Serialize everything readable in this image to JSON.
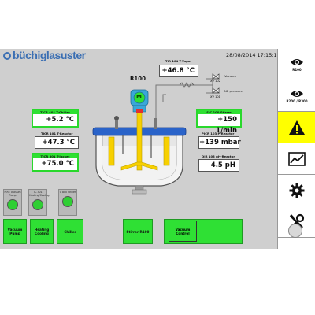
{
  "header": {
    "logo_text": "büchiglasuster",
    "datetime": "28/08/2014 17:15:19"
  },
  "reactor": {
    "title": "R100",
    "vapor_label": "TIR 104 T-Vapor",
    "vapor_value": "+46.8 °C",
    "chiller_label": "TICR 401 T-Chiller",
    "chiller_value": "+5.2 °C",
    "reactor_temp_label": "TICR 101 T-Reactor",
    "reactor_temp_value": "+47.3 °C",
    "jacket_label": "TICR 301 T-Jacket",
    "jacket_value": "+75.0 °C",
    "stirrer_label": "SIC 100 Stirrer",
    "stirrer_value": "+150 1/min",
    "pressure_label": "PICR 103 P-Reactor",
    "pressure_value": "+139 mbar",
    "ph_label": "QIR 103 pH-Reactor",
    "ph_value": "4.5 pH",
    "valve_vacuum_label": "Vacuum",
    "valve_n2_label": "N2 pressure",
    "valve1_tag": "XV 102",
    "valve2_tag": "XV 101",
    "stirrer_motor_letter": "M"
  },
  "indicators": [
    {
      "label": "P-RE Vacuum Pump"
    },
    {
      "label": "TC 301 Heating/Cooling"
    },
    {
      "label": "C 800 Chiller"
    }
  ],
  "buttons": {
    "vacuum_pump": "Vacuum Pump",
    "heating_cooling": "Heating Cooling",
    "chiller": "Chiller",
    "stirrer": "Stirrer R100",
    "vacuum_control": "Vacuum Control"
  },
  "sidebar": {
    "items": [
      {
        "caption": "R100",
        "icon": "eye-icon"
      },
      {
        "caption": "R200 / R300",
        "icon": "eye-icon"
      },
      {
        "caption": "",
        "icon": "warning-icon",
        "color": "#ffff00"
      },
      {
        "caption": "",
        "icon": "trend-chart-icon"
      },
      {
        "caption": "",
        "icon": "gear-icon"
      },
      {
        "caption": "",
        "icon": "tools-icon"
      }
    ]
  },
  "colors": {
    "accent_green": "#2fe034",
    "alarm_yellow": "#ffff00",
    "brand_blue": "#3b6fb3",
    "screen_gray": "#cfcfcf"
  }
}
